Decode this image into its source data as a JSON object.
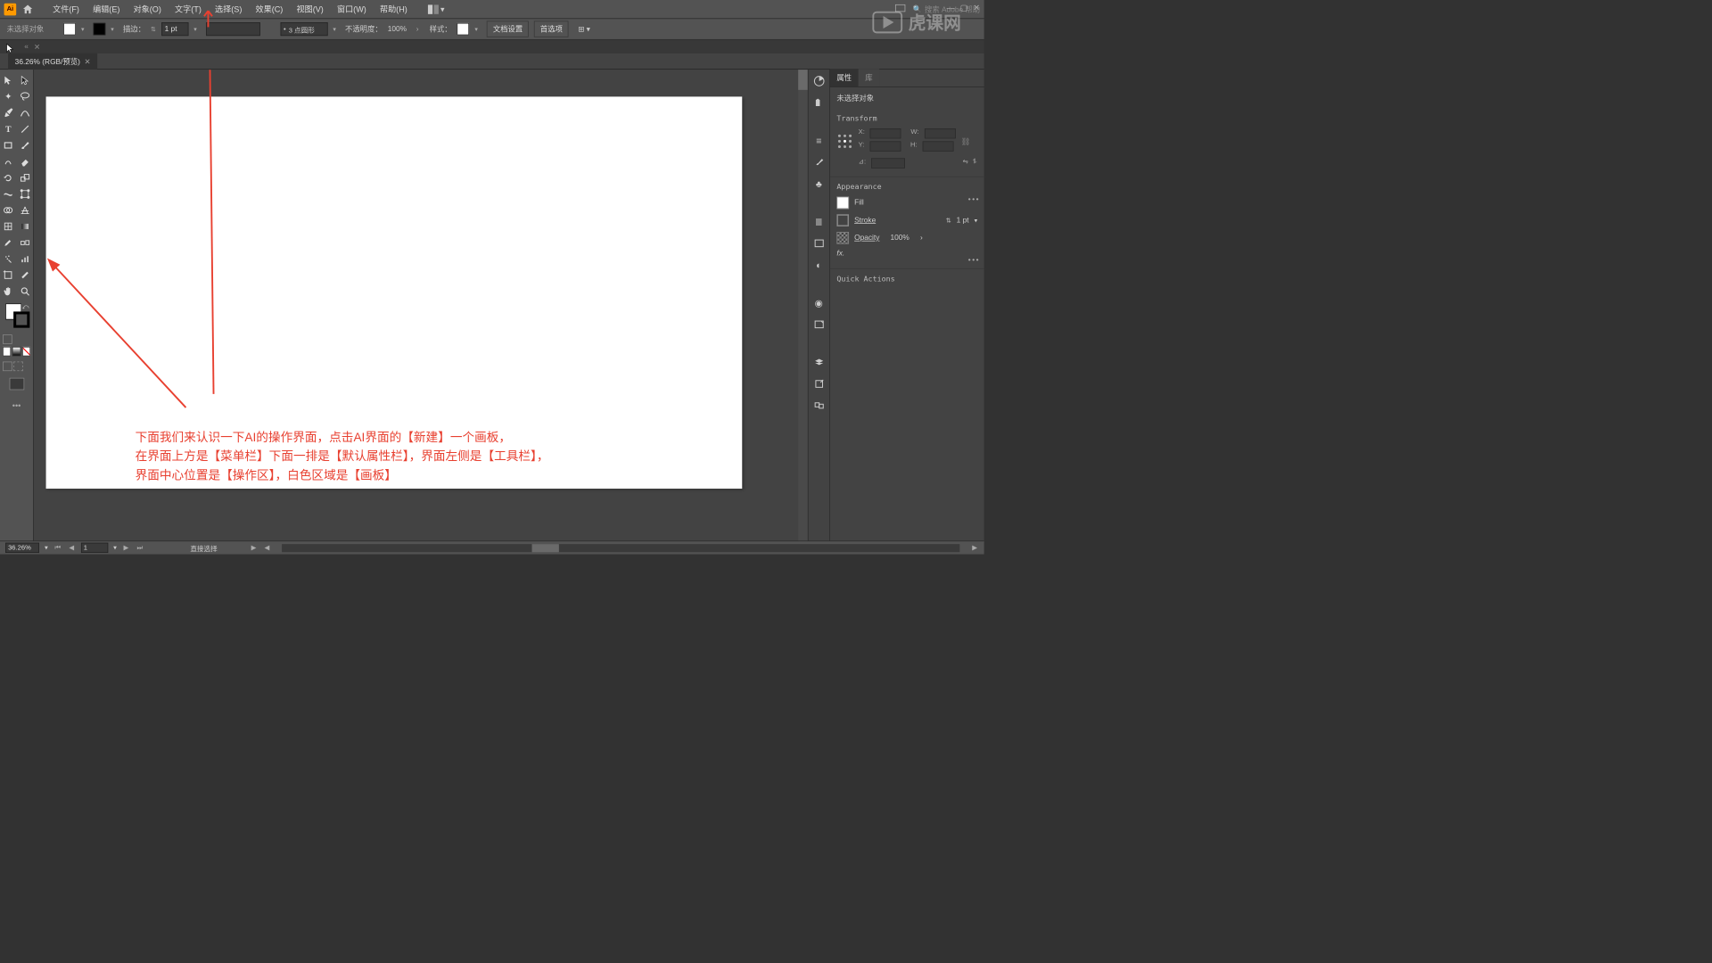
{
  "menu": {
    "file": "文件(F)",
    "edit": "编辑(E)",
    "object": "对象(O)",
    "type": "文字(T)",
    "select": "选择(S)",
    "effect": "效果(C)",
    "view": "视图(V)",
    "window": "窗口(W)",
    "help": "帮助(H)"
  },
  "search_placeholder": "搜索 Adobe 帮助",
  "control": {
    "noSelection": "未选择对象",
    "strokeLabel": "描边：",
    "strokeW": "1 pt",
    "brush": "3 点圆形",
    "opacityLabel": "不透明度：",
    "opacityVal": "100%",
    "styleLabel": "样式：",
    "docSetup": "文档设置",
    "prefs": "首选项"
  },
  "docTab": "36.26% (RGB/预览)",
  "properties": {
    "tabProps": "属性",
    "tabLib": "库",
    "noSel": "未选择对象",
    "transform": "Transform",
    "X": "X:",
    "Y": "Y:",
    "W": "W:",
    "H": "H:",
    "angle": "⊿:",
    "appearance": "Appearance",
    "fill": "Fill",
    "stroke": "Stroke",
    "strokeVal": "1 pt",
    "opacity": "Opacity",
    "opacityVal": "100%",
    "fx": "fx.",
    "quick": "Quick Actions"
  },
  "status": {
    "zoom": "36.26%",
    "art": "1",
    "tool": "直接选择"
  },
  "redText": {
    "l1": "下面我们来认识一下AI的操作界面，点击AI界面的【新建】一个画板，",
    "l2": "在界面上方是【菜单栏】下面一排是【默认属性栏】，界面左侧是【工具栏】，",
    "l3": "界面中心位置是【操作区】，白色区域是【画板】"
  },
  "watermark": "虎课网"
}
